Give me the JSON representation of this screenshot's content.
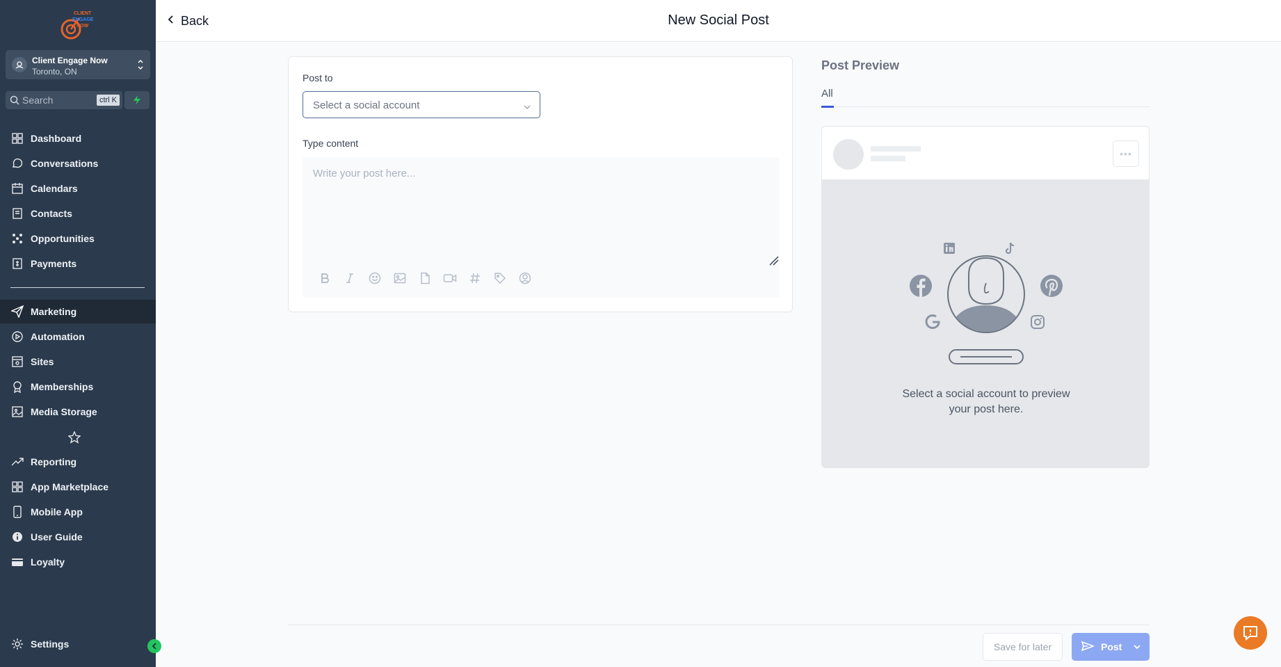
{
  "brand": {
    "logo_text": "CLIENT ENGAGE NOW"
  },
  "account": {
    "name": "Client Engage Now",
    "location": "Toronto, ON"
  },
  "search": {
    "placeholder": "Search",
    "shortcut": "ctrl K"
  },
  "sidebar": {
    "items": [
      {
        "label": "Dashboard",
        "icon": "dashboard-icon"
      },
      {
        "label": "Conversations",
        "icon": "chat-icon"
      },
      {
        "label": "Calendars",
        "icon": "calendar-icon"
      },
      {
        "label": "Contacts",
        "icon": "contacts-icon"
      },
      {
        "label": "Opportunities",
        "icon": "opportunities-icon"
      },
      {
        "label": "Payments",
        "icon": "payments-icon"
      }
    ],
    "items2": [
      {
        "label": "Marketing",
        "icon": "send-icon",
        "active": true
      },
      {
        "label": "Automation",
        "icon": "automation-icon"
      },
      {
        "label": "Sites",
        "icon": "sites-icon"
      },
      {
        "label": "Memberships",
        "icon": "membership-icon"
      },
      {
        "label": "Media Storage",
        "icon": "media-icon"
      }
    ],
    "items3": [
      {
        "label": "Reporting",
        "icon": "trend-icon"
      },
      {
        "label": "App Marketplace",
        "icon": "apps-icon"
      },
      {
        "label": "Mobile App",
        "icon": "mobile-icon"
      },
      {
        "label": "User Guide",
        "icon": "info-icon"
      },
      {
        "label": "Loyalty",
        "icon": "loyalty-icon"
      }
    ],
    "settings": "Settings"
  },
  "header": {
    "back": "Back",
    "title": "New Social Post"
  },
  "compose": {
    "post_to_label": "Post to",
    "select_placeholder": "Select a social account",
    "content_label": "Type content",
    "content_placeholder": "Write your post here..."
  },
  "preview": {
    "title": "Post Preview",
    "tab_all": "All",
    "message": "Select a social account to preview your post here."
  },
  "footer": {
    "save": "Save for later",
    "post": "Post"
  },
  "colors": {
    "sidebar": "#2b3a4c",
    "accent": "#3b5bdb",
    "help": "#ea7a25",
    "post": "#8da8f2"
  }
}
